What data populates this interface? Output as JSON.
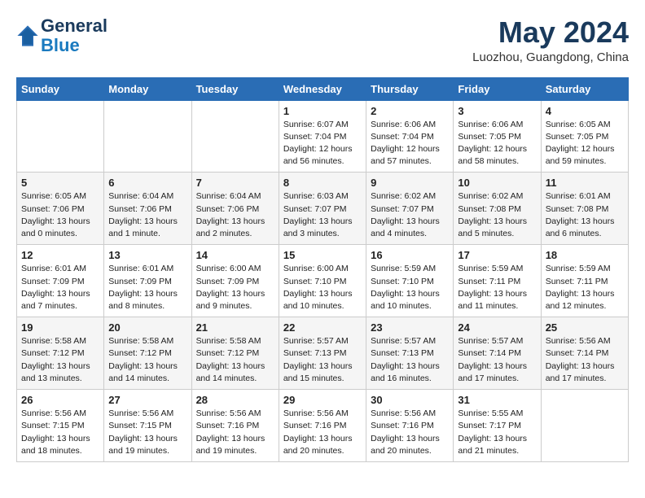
{
  "logo": {
    "line1": "General",
    "line2": "Blue"
  },
  "title": "May 2024",
  "location": "Luozhou, Guangdong, China",
  "days_of_week": [
    "Sunday",
    "Monday",
    "Tuesday",
    "Wednesday",
    "Thursday",
    "Friday",
    "Saturday"
  ],
  "weeks": [
    [
      {
        "day": "",
        "sunrise": "",
        "sunset": "",
        "daylight": ""
      },
      {
        "day": "",
        "sunrise": "",
        "sunset": "",
        "daylight": ""
      },
      {
        "day": "",
        "sunrise": "",
        "sunset": "",
        "daylight": ""
      },
      {
        "day": "1",
        "sunrise": "Sunrise: 6:07 AM",
        "sunset": "Sunset: 7:04 PM",
        "daylight": "Daylight: 12 hours and 56 minutes."
      },
      {
        "day": "2",
        "sunrise": "Sunrise: 6:06 AM",
        "sunset": "Sunset: 7:04 PM",
        "daylight": "Daylight: 12 hours and 57 minutes."
      },
      {
        "day": "3",
        "sunrise": "Sunrise: 6:06 AM",
        "sunset": "Sunset: 7:05 PM",
        "daylight": "Daylight: 12 hours and 58 minutes."
      },
      {
        "day": "4",
        "sunrise": "Sunrise: 6:05 AM",
        "sunset": "Sunset: 7:05 PM",
        "daylight": "Daylight: 12 hours and 59 minutes."
      }
    ],
    [
      {
        "day": "5",
        "sunrise": "Sunrise: 6:05 AM",
        "sunset": "Sunset: 7:06 PM",
        "daylight": "Daylight: 13 hours and 0 minutes."
      },
      {
        "day": "6",
        "sunrise": "Sunrise: 6:04 AM",
        "sunset": "Sunset: 7:06 PM",
        "daylight": "Daylight: 13 hours and 1 minute."
      },
      {
        "day": "7",
        "sunrise": "Sunrise: 6:04 AM",
        "sunset": "Sunset: 7:06 PM",
        "daylight": "Daylight: 13 hours and 2 minutes."
      },
      {
        "day": "8",
        "sunrise": "Sunrise: 6:03 AM",
        "sunset": "Sunset: 7:07 PM",
        "daylight": "Daylight: 13 hours and 3 minutes."
      },
      {
        "day": "9",
        "sunrise": "Sunrise: 6:02 AM",
        "sunset": "Sunset: 7:07 PM",
        "daylight": "Daylight: 13 hours and 4 minutes."
      },
      {
        "day": "10",
        "sunrise": "Sunrise: 6:02 AM",
        "sunset": "Sunset: 7:08 PM",
        "daylight": "Daylight: 13 hours and 5 minutes."
      },
      {
        "day": "11",
        "sunrise": "Sunrise: 6:01 AM",
        "sunset": "Sunset: 7:08 PM",
        "daylight": "Daylight: 13 hours and 6 minutes."
      }
    ],
    [
      {
        "day": "12",
        "sunrise": "Sunrise: 6:01 AM",
        "sunset": "Sunset: 7:09 PM",
        "daylight": "Daylight: 13 hours and 7 minutes."
      },
      {
        "day": "13",
        "sunrise": "Sunrise: 6:01 AM",
        "sunset": "Sunset: 7:09 PM",
        "daylight": "Daylight: 13 hours and 8 minutes."
      },
      {
        "day": "14",
        "sunrise": "Sunrise: 6:00 AM",
        "sunset": "Sunset: 7:09 PM",
        "daylight": "Daylight: 13 hours and 9 minutes."
      },
      {
        "day": "15",
        "sunrise": "Sunrise: 6:00 AM",
        "sunset": "Sunset: 7:10 PM",
        "daylight": "Daylight: 13 hours and 10 minutes."
      },
      {
        "day": "16",
        "sunrise": "Sunrise: 5:59 AM",
        "sunset": "Sunset: 7:10 PM",
        "daylight": "Daylight: 13 hours and 10 minutes."
      },
      {
        "day": "17",
        "sunrise": "Sunrise: 5:59 AM",
        "sunset": "Sunset: 7:11 PM",
        "daylight": "Daylight: 13 hours and 11 minutes."
      },
      {
        "day": "18",
        "sunrise": "Sunrise: 5:59 AM",
        "sunset": "Sunset: 7:11 PM",
        "daylight": "Daylight: 13 hours and 12 minutes."
      }
    ],
    [
      {
        "day": "19",
        "sunrise": "Sunrise: 5:58 AM",
        "sunset": "Sunset: 7:12 PM",
        "daylight": "Daylight: 13 hours and 13 minutes."
      },
      {
        "day": "20",
        "sunrise": "Sunrise: 5:58 AM",
        "sunset": "Sunset: 7:12 PM",
        "daylight": "Daylight: 13 hours and 14 minutes."
      },
      {
        "day": "21",
        "sunrise": "Sunrise: 5:58 AM",
        "sunset": "Sunset: 7:12 PM",
        "daylight": "Daylight: 13 hours and 14 minutes."
      },
      {
        "day": "22",
        "sunrise": "Sunrise: 5:57 AM",
        "sunset": "Sunset: 7:13 PM",
        "daylight": "Daylight: 13 hours and 15 minutes."
      },
      {
        "day": "23",
        "sunrise": "Sunrise: 5:57 AM",
        "sunset": "Sunset: 7:13 PM",
        "daylight": "Daylight: 13 hours and 16 minutes."
      },
      {
        "day": "24",
        "sunrise": "Sunrise: 5:57 AM",
        "sunset": "Sunset: 7:14 PM",
        "daylight": "Daylight: 13 hours and 17 minutes."
      },
      {
        "day": "25",
        "sunrise": "Sunrise: 5:56 AM",
        "sunset": "Sunset: 7:14 PM",
        "daylight": "Daylight: 13 hours and 17 minutes."
      }
    ],
    [
      {
        "day": "26",
        "sunrise": "Sunrise: 5:56 AM",
        "sunset": "Sunset: 7:15 PM",
        "daylight": "Daylight: 13 hours and 18 minutes."
      },
      {
        "day": "27",
        "sunrise": "Sunrise: 5:56 AM",
        "sunset": "Sunset: 7:15 PM",
        "daylight": "Daylight: 13 hours and 19 minutes."
      },
      {
        "day": "28",
        "sunrise": "Sunrise: 5:56 AM",
        "sunset": "Sunset: 7:16 PM",
        "daylight": "Daylight: 13 hours and 19 minutes."
      },
      {
        "day": "29",
        "sunrise": "Sunrise: 5:56 AM",
        "sunset": "Sunset: 7:16 PM",
        "daylight": "Daylight: 13 hours and 20 minutes."
      },
      {
        "day": "30",
        "sunrise": "Sunrise: 5:56 AM",
        "sunset": "Sunset: 7:16 PM",
        "daylight": "Daylight: 13 hours and 20 minutes."
      },
      {
        "day": "31",
        "sunrise": "Sunrise: 5:55 AM",
        "sunset": "Sunset: 7:17 PM",
        "daylight": "Daylight: 13 hours and 21 minutes."
      },
      {
        "day": "",
        "sunrise": "",
        "sunset": "",
        "daylight": ""
      }
    ]
  ]
}
